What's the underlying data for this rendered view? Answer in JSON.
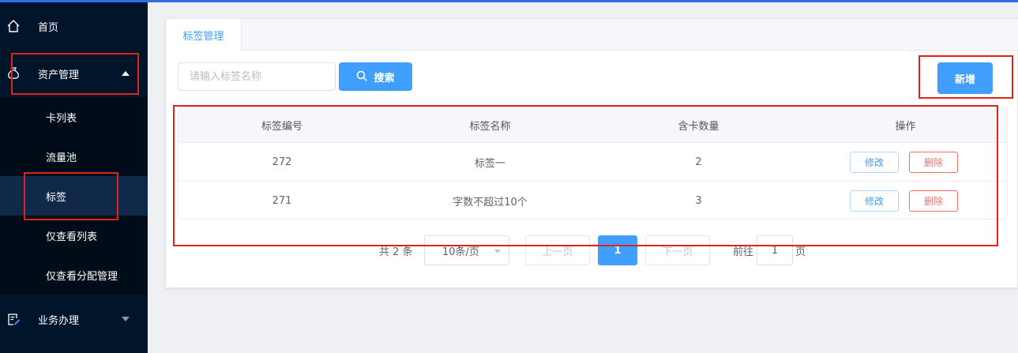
{
  "colors": {
    "sidebar_bg": "#001529",
    "accent": "#409eff",
    "danger": "#f56c6c",
    "annotation": "#e5211d"
  },
  "sidebar": {
    "home": {
      "label": "首页",
      "icon": "home-icon"
    },
    "assets": {
      "label": "资产管理",
      "icon": "money-bag-icon",
      "expanded": true
    },
    "sub_items": [
      {
        "label": "卡列表"
      },
      {
        "label": "流量池"
      },
      {
        "label": "标签",
        "active": true
      },
      {
        "label": "仅查看列表"
      },
      {
        "label": "仅查看分配管理"
      }
    ],
    "business": {
      "label": "业务办理",
      "icon": "edit-document-icon",
      "expanded": false
    }
  },
  "main": {
    "tab_label": "标签管理",
    "search": {
      "placeholder": "请输入标签名称",
      "value": ""
    },
    "search_button": "搜索",
    "add_button": "新增",
    "table": {
      "headers": [
        "标签编号",
        "标签名称",
        "含卡数量",
        "操作"
      ],
      "rows": [
        {
          "id": "272",
          "name": "标签一",
          "count": "2",
          "edit": "修改",
          "delete": "删除"
        },
        {
          "id": "271",
          "name": "字数不超过10个",
          "count": "3",
          "edit": "修改",
          "delete": "删除"
        }
      ]
    },
    "pagination": {
      "total_text": "共 2 条",
      "page_size": "10条/页",
      "prev": "上一页",
      "current_page": "1",
      "next": "下一页",
      "goto_label": "前往",
      "goto_value": "1",
      "page_suffix": "页"
    }
  }
}
